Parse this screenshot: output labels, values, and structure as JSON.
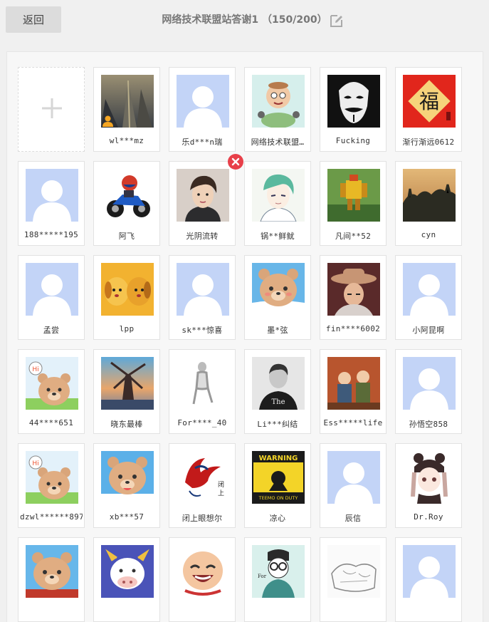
{
  "header": {
    "back_label": "返回",
    "title": "网络技术联盟站答谢1 （150/200）"
  },
  "colors": {
    "remove": "#e8404a",
    "owner": "#f5a623",
    "default_avatar_bg": "#c3d4f7"
  },
  "members": [
    {
      "name": "wl***mz",
      "avatar": "city-tower",
      "owner": true
    },
    {
      "name": "乐d***n瑞",
      "avatar": "default"
    },
    {
      "name": "网络技术联盟…",
      "avatar": "cartoon-man"
    },
    {
      "name": "Fucking",
      "avatar": "guy-fawkes-mask"
    },
    {
      "name": "渐行渐远0612",
      "avatar": "fu-character"
    },
    {
      "name": "188*****195",
      "avatar": "default"
    },
    {
      "name": "阿飞",
      "avatar": "motorcycle"
    },
    {
      "name": "光阴流转",
      "avatar": "young-man-photo",
      "selected": true
    },
    {
      "name": "锅**鲜鱿",
      "avatar": "anime-boy"
    },
    {
      "name": "凡间**52",
      "avatar": "robot-statue"
    },
    {
      "name": "cyn",
      "avatar": "sunset-landscape"
    },
    {
      "name": "孟尝",
      "avatar": "default"
    },
    {
      "name": "lpp",
      "avatar": "plush-dogs"
    },
    {
      "name": "sk***惊喜",
      "avatar": "default"
    },
    {
      "name": "墨*弦",
      "avatar": "bear"
    },
    {
      "name": "fin****6002",
      "avatar": "cowboy-hat-man"
    },
    {
      "name": "小阿昆啊",
      "avatar": "default"
    },
    {
      "name": "44****651",
      "avatar": "bear-hi"
    },
    {
      "name": "晓东最棒",
      "avatar": "windmill"
    },
    {
      "name": "For****_40",
      "avatar": "sketch-figure"
    },
    {
      "name": "Li***纠结",
      "avatar": "bw-man-tshirt"
    },
    {
      "name": "Ess*****life",
      "avatar": "kids-photo"
    },
    {
      "name": "孙悟空858",
      "avatar": "default"
    },
    {
      "name": "dzwl******8972",
      "avatar": "bear-hi"
    },
    {
      "name": "xb***57",
      "avatar": "bear-blue"
    },
    {
      "name": "闭上眼想尔",
      "avatar": "phoenix-calligraphy"
    },
    {
      "name": "凉心",
      "avatar": "warning-sign"
    },
    {
      "name": "辰信",
      "avatar": "default"
    },
    {
      "name": "Dr.Roy",
      "avatar": "anime-girl-bear-hat"
    },
    {
      "name": "",
      "avatar": "bear-sky"
    },
    {
      "name": "",
      "avatar": "cow"
    },
    {
      "name": "",
      "avatar": "laughing-face"
    },
    {
      "name": "",
      "avatar": "glasses-sketch"
    },
    {
      "name": "",
      "avatar": "pencil-sketch"
    },
    {
      "name": "",
      "avatar": "default"
    }
  ]
}
